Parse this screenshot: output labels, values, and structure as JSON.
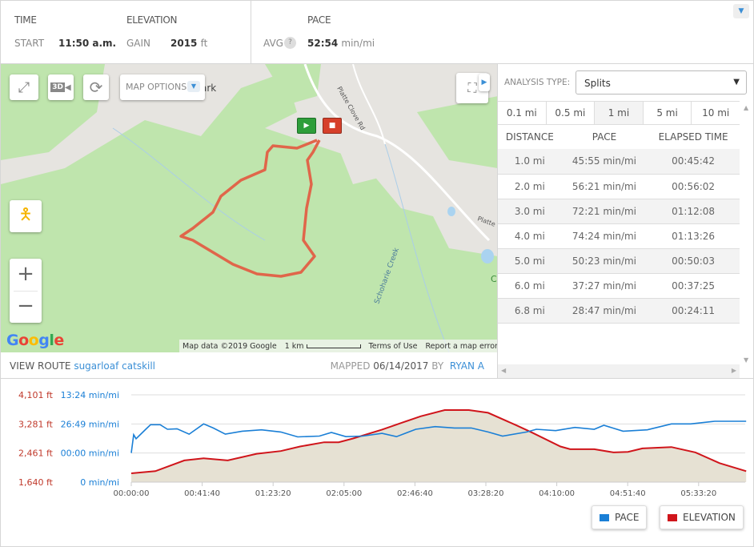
{
  "summary": {
    "time_label": "TIME",
    "start_label": "START",
    "start_value": "11:50 a.m.",
    "elevation_label": "ELEVATION",
    "gain_label": "GAIN",
    "gain_value": "2015",
    "gain_unit": "ft",
    "pace_label": "PACE",
    "avg_label": "AVG",
    "help": "?",
    "avg_value": "52:54",
    "avg_unit": "min/mi"
  },
  "map": {
    "controls": {
      "fullscreen": "expand-icon",
      "threed": "3D",
      "rotate": "rotate-icon",
      "map_options": "MAP OPTIONS"
    },
    "place_fragment": "ark",
    "roads": [
      "Platte Clove Rd",
      "Platte C",
      "Schoharie Creek"
    ],
    "edge_label": "C",
    "google": "Google",
    "attribution": {
      "data": "Map data ©2019 Google",
      "scale": "1 km",
      "terms": "Terms of Use",
      "report": "Report a map error"
    },
    "route_color": "#e0664a"
  },
  "route": {
    "view_label": "VIEW ROUTE",
    "route_name": "sugarloaf catskill",
    "mapped_label": "MAPPED",
    "mapped_date": "06/14/2017",
    "by_label": "BY",
    "author": "RYAN A"
  },
  "analysis": {
    "type_label": "ANALYSIS TYPE:",
    "type_value": "Splits",
    "tabs": [
      "0.1 mi",
      "0.5 mi",
      "1 mi",
      "5 mi",
      "10 mi"
    ],
    "active_tab": "1 mi",
    "headers": [
      "DISTANCE",
      "PACE",
      "ELAPSED TIME"
    ],
    "rows": [
      [
        "1.0 mi",
        "45:55 min/mi",
        "00:45:42"
      ],
      [
        "2.0 mi",
        "56:21 min/mi",
        "00:56:02"
      ],
      [
        "3.0 mi",
        "72:21 min/mi",
        "01:12:08"
      ],
      [
        "4.0 mi",
        "74:24 min/mi",
        "01:13:26"
      ],
      [
        "5.0 mi",
        "50:23 min/mi",
        "00:50:03"
      ],
      [
        "6.0 mi",
        "37:27 min/mi",
        "00:37:25"
      ],
      [
        "6.8 mi",
        "28:47 min/mi",
        "00:24:11"
      ]
    ]
  },
  "chart_data": {
    "type": "line",
    "x_ticks": [
      "00:00:00",
      "00:41:40",
      "01:23:20",
      "02:05:00",
      "02:46:40",
      "03:28:20",
      "04:10:00",
      "04:51:40",
      "05:33:20"
    ],
    "y_left_ticks": [
      "1,640 ft",
      "2,461 ft",
      "3,281 ft",
      "4,101 ft"
    ],
    "y_left_values": [
      1640,
      2461,
      3281,
      4101
    ],
    "y_right_ticks": [
      "0 min/mi",
      "00:00 min/mi",
      "26:49 min/mi",
      "13:24 min/mi"
    ],
    "grid": true,
    "legend": "bottom-right",
    "series": [
      {
        "name": "ELEVATION",
        "color": "#d0151b",
        "fill": "#e6e1d3",
        "points": [
          [
            "0:00:00",
            1889
          ],
          [
            "0:14:10",
            1950
          ],
          [
            "0:31:10",
            2252
          ],
          [
            "0:42:30",
            2312
          ],
          [
            "0:56:40",
            2252
          ],
          [
            "1:13:40",
            2440
          ],
          [
            "1:27:50",
            2516
          ],
          [
            "1:39:10",
            2644
          ],
          [
            "1:53:20",
            2765
          ],
          [
            "2:01:50",
            2765
          ],
          [
            "2:10:20",
            2871
          ],
          [
            "2:27:20",
            3120
          ],
          [
            "2:38:40",
            3309
          ],
          [
            "2:50:00",
            3497
          ],
          [
            "3:04:10",
            3671
          ],
          [
            "3:18:20",
            3671
          ],
          [
            "3:29:40",
            3595
          ],
          [
            "3:46:40",
            3233
          ],
          [
            "3:55:10",
            3044
          ],
          [
            "4:12:10",
            2644
          ],
          [
            "4:17:50",
            2569
          ],
          [
            "4:32:00",
            2569
          ],
          [
            "4:43:20",
            2478
          ],
          [
            "4:51:50",
            2493
          ],
          [
            "5:00:20",
            2591
          ],
          [
            "5:17:20",
            2629
          ],
          [
            "5:31:30",
            2478
          ],
          [
            "5:45:40",
            2176
          ],
          [
            "6:01:15",
            1950
          ]
        ]
      },
      {
        "name": "PACE",
        "color": "#1a7fd6",
        "points": [
          [
            "0:00:00",
            0
          ],
          [
            "0:01:25",
            16.9
          ],
          [
            "0:02:50",
            13.2
          ],
          [
            "0:08:30",
            21.9
          ],
          [
            "0:11:20",
            26.1
          ],
          [
            "0:17:00",
            26.1
          ],
          [
            "0:21:15",
            21.9
          ],
          [
            "0:26:55",
            22.3
          ],
          [
            "0:34:00",
            17.4
          ],
          [
            "0:42:30",
            26.8
          ],
          [
            "0:48:10",
            23.1
          ],
          [
            "0:55:15",
            17.4
          ],
          [
            "1:05:10",
            20.1
          ],
          [
            "1:16:30",
            21.4
          ],
          [
            "1:27:50",
            19.4
          ],
          [
            "1:37:45",
            14.9
          ],
          [
            "1:50:30",
            15.6
          ],
          [
            "1:57:35",
            18.9
          ],
          [
            "2:06:05",
            15.1
          ],
          [
            "2:16:00",
            15.6
          ],
          [
            "2:27:20",
            18.1
          ],
          [
            "2:35:50",
            15.1
          ],
          [
            "2:47:10",
            21.9
          ],
          [
            "2:58:30",
            24.3
          ],
          [
            "3:09:50",
            23.1
          ],
          [
            "3:19:45",
            23.1
          ],
          [
            "3:29:40",
            19.4
          ],
          [
            "3:38:10",
            15.6
          ],
          [
            "3:52:20",
            19.4
          ],
          [
            "3:58:00",
            21.9
          ],
          [
            "4:09:20",
            20.6
          ],
          [
            "4:20:40",
            23.6
          ],
          [
            "4:32:00",
            21.9
          ],
          [
            "4:37:40",
            25.6
          ],
          [
            "4:49:00",
            20.1
          ],
          [
            "5:03:10",
            21.4
          ],
          [
            "5:17:20",
            26.8
          ],
          [
            "5:28:40",
            26.8
          ],
          [
            "5:42:50",
            29.3
          ],
          [
            "6:01:15",
            29.3
          ]
        ]
      }
    ]
  }
}
